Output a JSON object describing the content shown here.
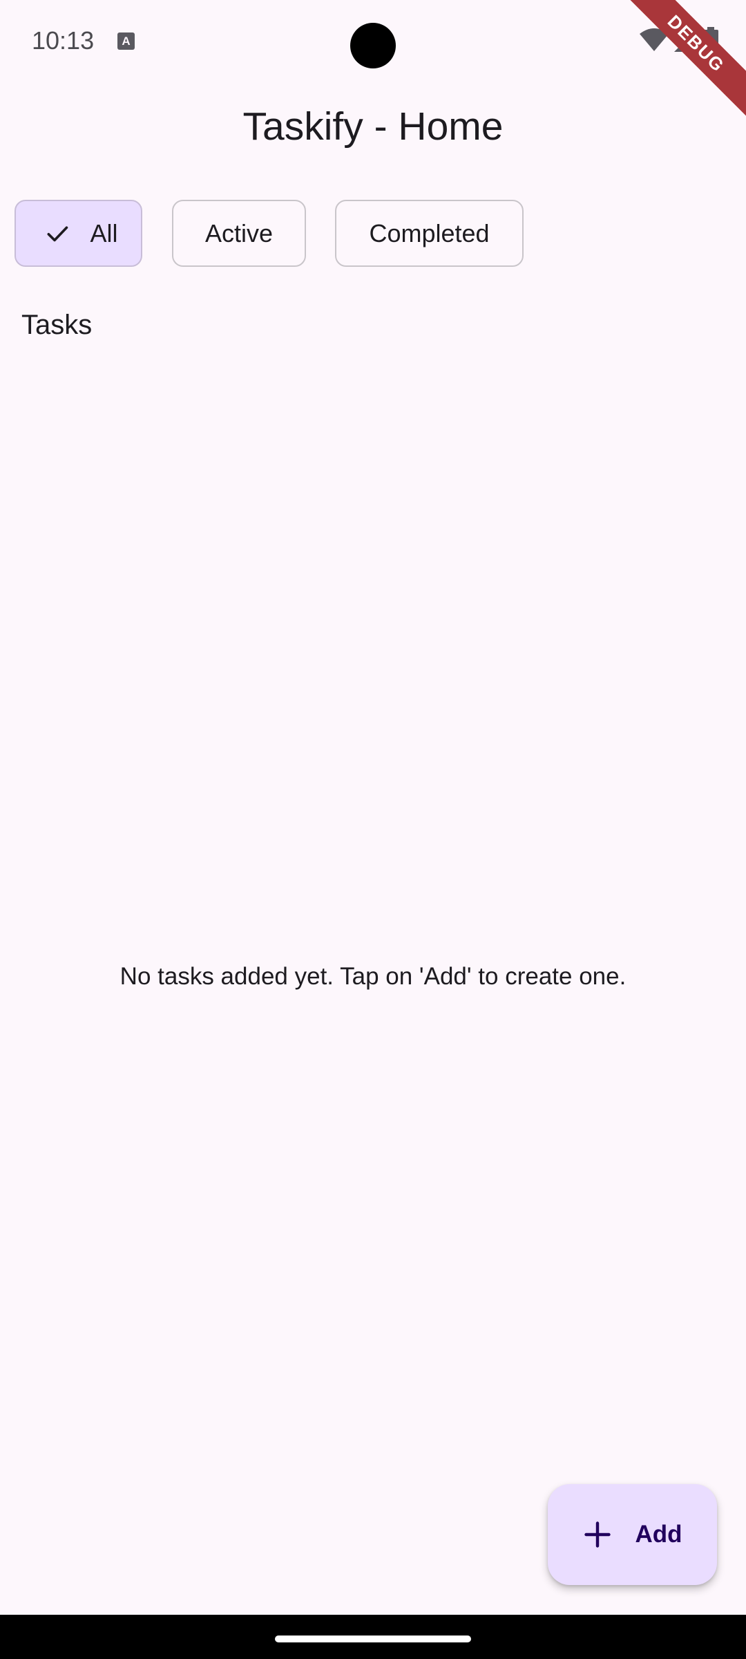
{
  "status_bar": {
    "time": "10:13",
    "notification_icon_letter": "A",
    "icons": [
      "wifi-icon",
      "cell-signal-icon",
      "battery-icon"
    ]
  },
  "debug_banner": "DEBUG",
  "app_bar": {
    "title": "Taskify - Home"
  },
  "filters": {
    "options": [
      {
        "label": "All",
        "selected": true
      },
      {
        "label": "Active",
        "selected": false
      },
      {
        "label": "Completed",
        "selected": false
      }
    ]
  },
  "tasks": {
    "section_title": "Tasks",
    "items": [],
    "empty_message": "No tasks added yet. Tap on 'Add' to create one."
  },
  "fab": {
    "label": "Add",
    "icon": "plus-icon"
  },
  "colors": {
    "background": "#FDF7FC",
    "chip_selected": "#E9DDFF",
    "fab_background": "#EADDFF",
    "fab_foreground": "#21005D",
    "debug_ribbon": "#A9363A"
  }
}
